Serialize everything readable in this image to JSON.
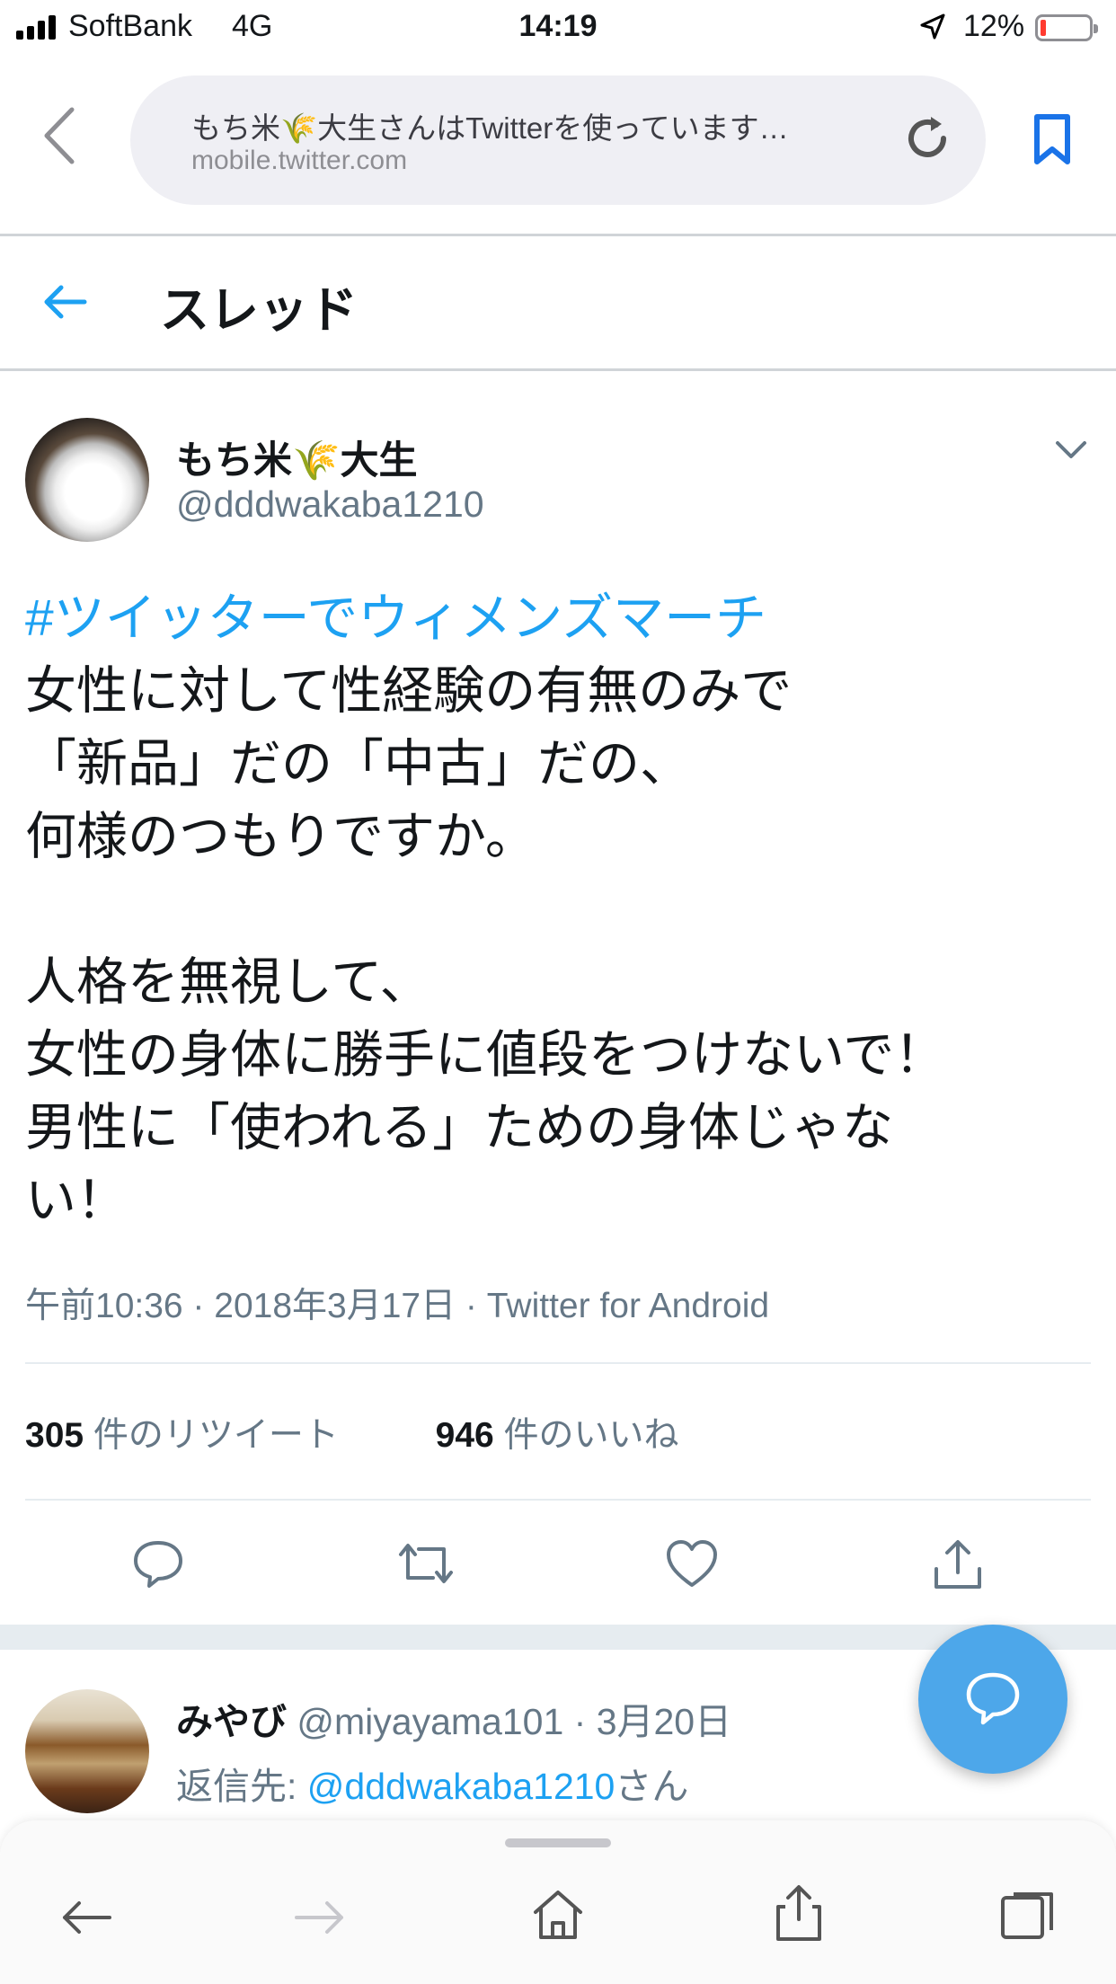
{
  "status_bar": {
    "carrier": "SoftBank",
    "network": "4G",
    "time": "14:19",
    "battery_percent": "12%",
    "battery_level": 0.12
  },
  "browser": {
    "page_title": "もち米🌾大生さんはTwitterを使っています…",
    "host": "mobile.twitter.com"
  },
  "header": {
    "title": "スレッド"
  },
  "tweet": {
    "author_name": "もち米🌾大生",
    "author_handle": "@dddwakaba1210",
    "hashtag": "#ツイッターでウィメンズマーチ",
    "lines": [
      "女性に対して性経験の有無のみで",
      "「新品」だの「中古」だの、",
      "何様のつもりですか。",
      "",
      "人格を無視して、",
      "女性の身体に勝手に値段をつけないで！",
      "男性に「使われる」ための身体じゃな",
      "い！"
    ],
    "meta": "午前10:36 · 2018年3月17日 · Twitter for Android",
    "retweets_count": "305",
    "retweets_label": "件のリツイート",
    "likes_count": "946",
    "likes_label": "件のいいね"
  },
  "reply": {
    "name": "みやび",
    "handle_date": "@miyayama101 · 3月20日",
    "reply_to_prefix": "返信先: ",
    "reply_to_mention": "@dddwakaba1210",
    "reply_to_suffix": "さん"
  },
  "icons": {
    "accent": "#1da1f2",
    "fab_color": "#4da7ea",
    "browser_blue": "#1a73e8"
  }
}
